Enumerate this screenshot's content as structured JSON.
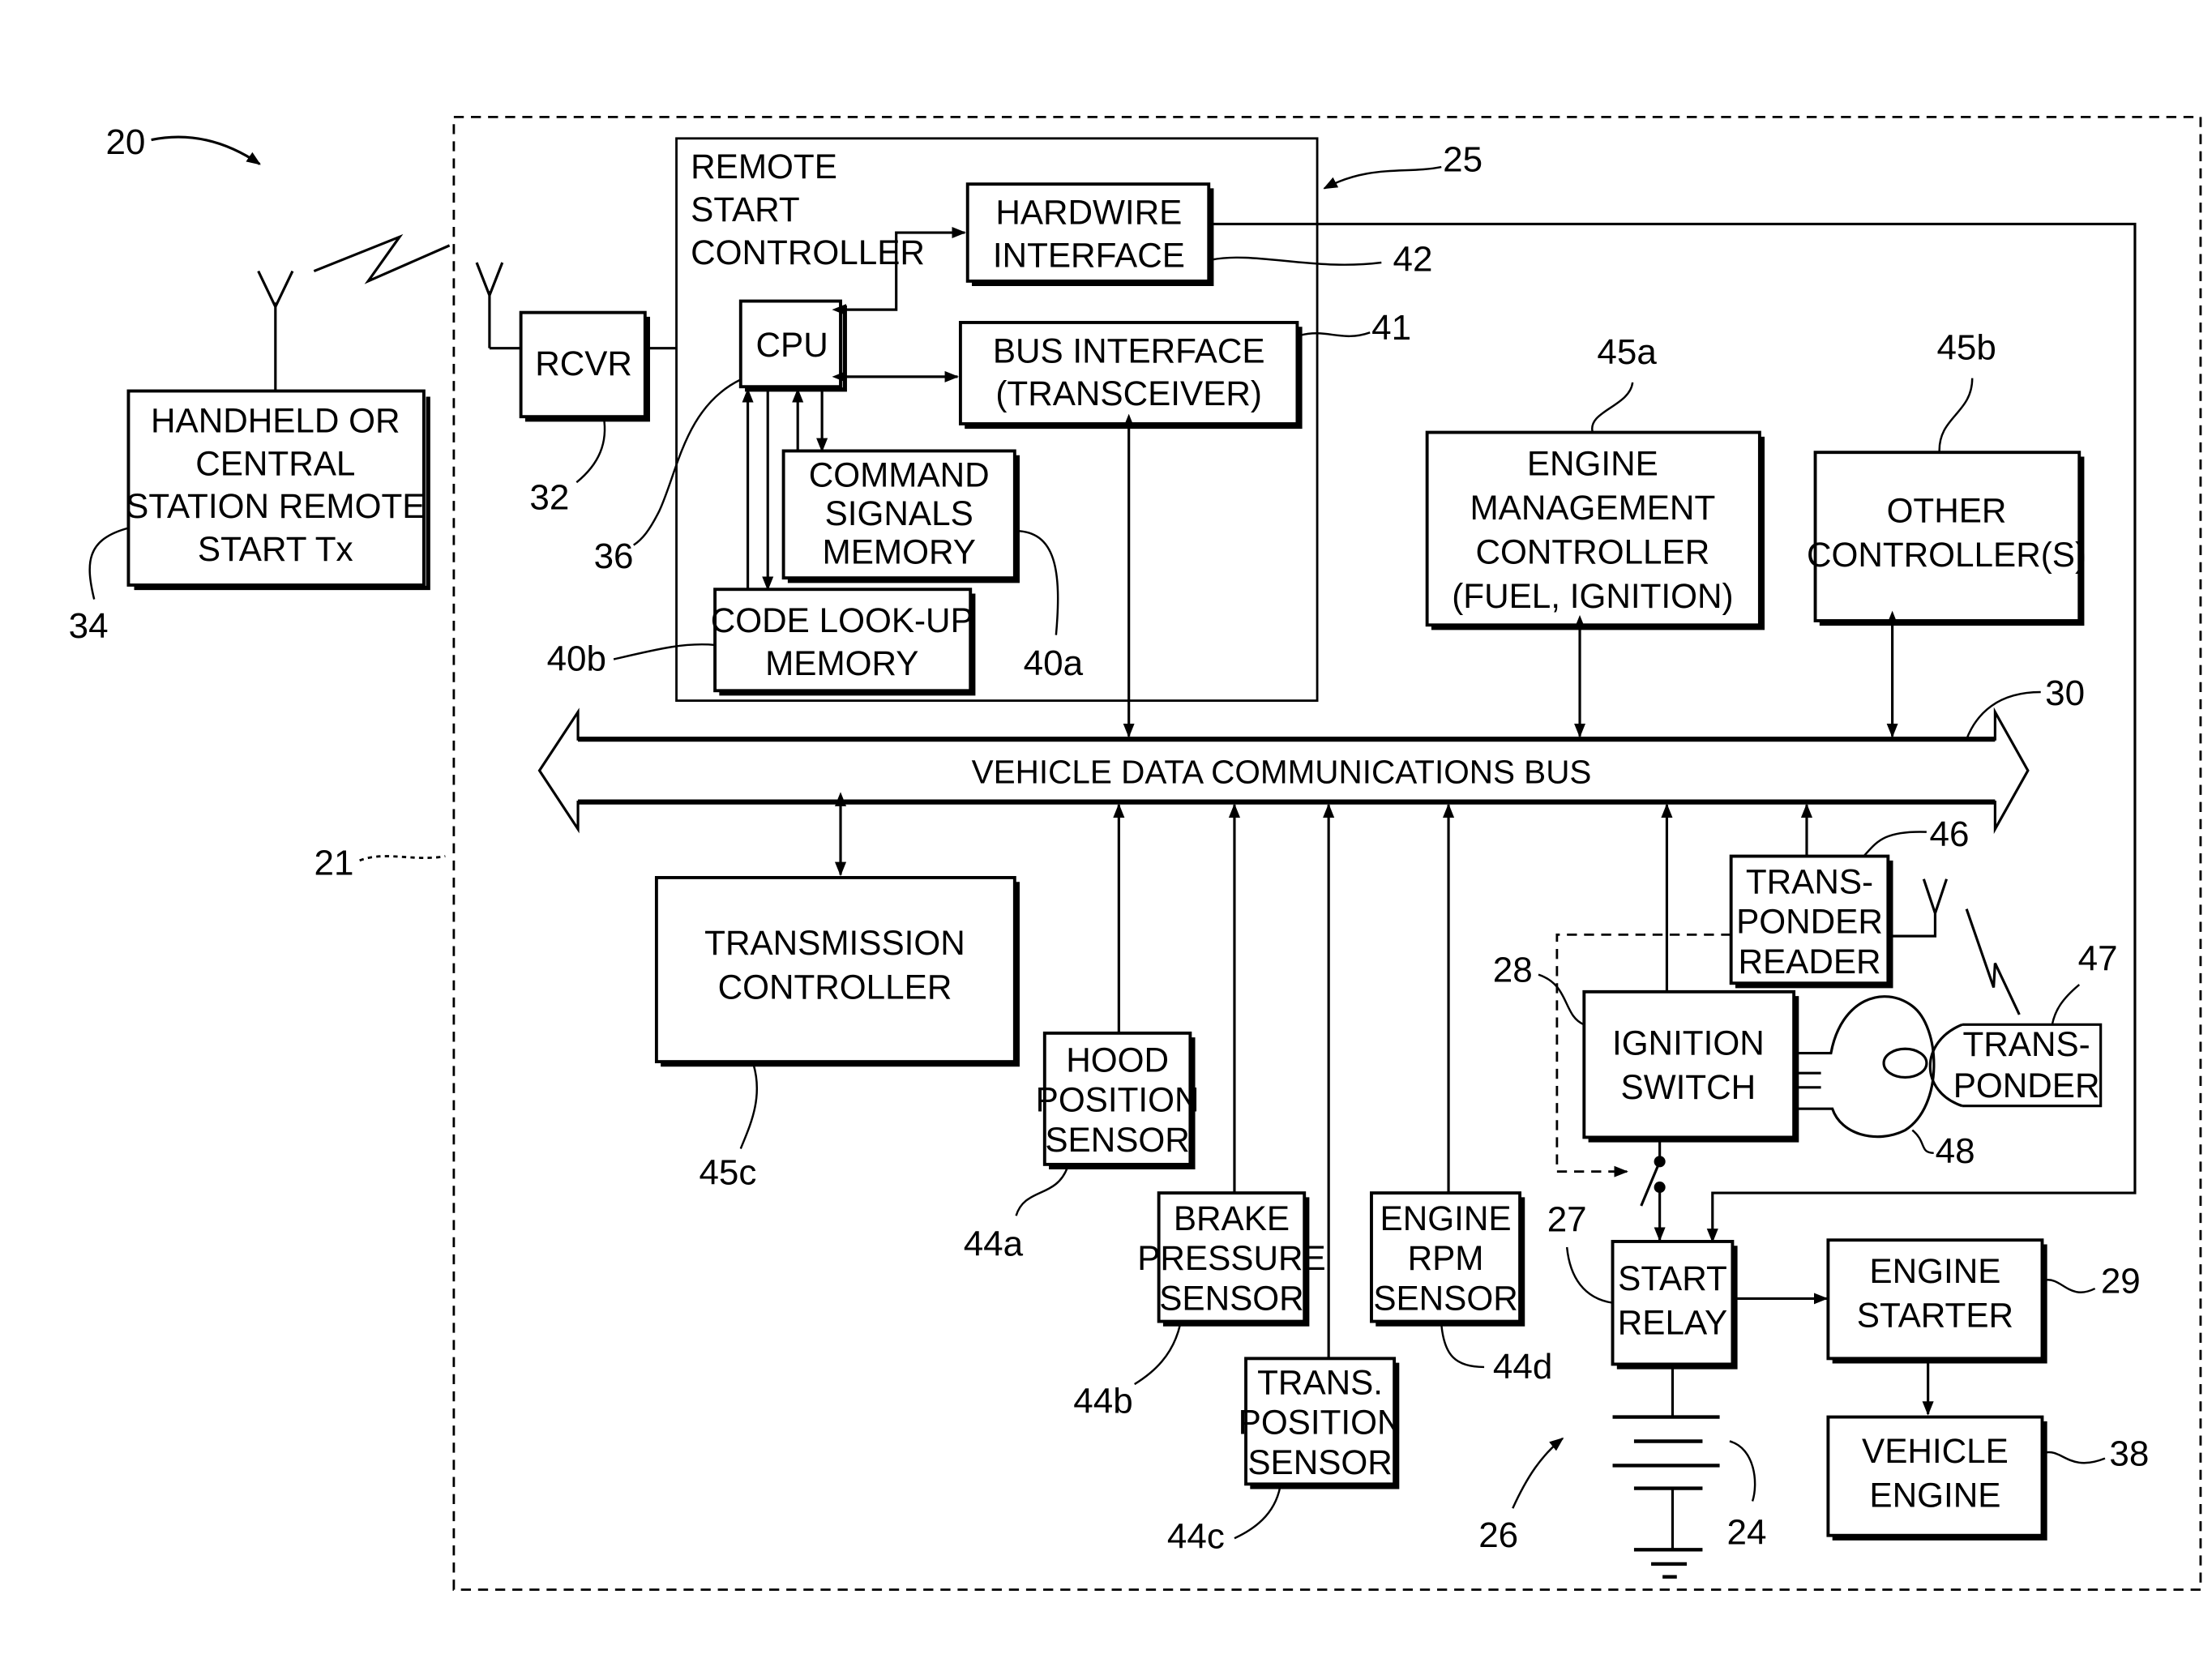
{
  "figure": {
    "ref": "20",
    "vehicle_boundary_ref": "21",
    "remote_start_controller_ref": "25",
    "bus_ref": "30"
  },
  "blocks": {
    "handheld": {
      "lines": [
        "HANDHELD OR",
        "CENTRAL",
        "STATION REMOTE",
        "START Tx"
      ],
      "ref": "34"
    },
    "rcvr": {
      "lines": [
        "RCVR"
      ],
      "ref": "32"
    },
    "remote_start_controller": {
      "lines": [
        "REMOTE",
        "START",
        "CONTROLLER"
      ]
    },
    "cpu": {
      "lines": [
        "CPU"
      ],
      "ref": "36"
    },
    "hardwire_interface": {
      "lines": [
        "HARDWIRE",
        "INTERFACE"
      ],
      "ref": "42"
    },
    "bus_interface": {
      "lines": [
        "BUS INTERFACE",
        "(TRANSCEIVER)"
      ],
      "ref": "41"
    },
    "command_signals_memory": {
      "lines": [
        "COMMAND",
        "SIGNALS",
        "MEMORY"
      ],
      "ref": "40a"
    },
    "code_lookup_memory": {
      "lines": [
        "CODE LOOK-UP",
        "MEMORY"
      ],
      "ref": "40b"
    },
    "engine_management": {
      "lines": [
        "ENGINE",
        "MANAGEMENT",
        "CONTROLLER",
        "(FUEL, IGNITION)"
      ],
      "ref": "45a"
    },
    "other_controllers": {
      "lines": [
        "OTHER",
        "CONTROLLER(S)"
      ],
      "ref": "45b"
    },
    "transmission_controller": {
      "lines": [
        "TRANSMISSION",
        "CONTROLLER"
      ],
      "ref": "45c"
    },
    "hood_sensor": {
      "lines": [
        "HOOD",
        "POSITION",
        "SENSOR"
      ],
      "ref": "44a"
    },
    "brake_sensor": {
      "lines": [
        "BRAKE",
        "PRESSURE",
        "SENSOR"
      ],
      "ref": "44b"
    },
    "trans_sensor": {
      "lines": [
        "TRANS.",
        "POSITION",
        "SENSOR"
      ],
      "ref": "44c"
    },
    "rpm_sensor": {
      "lines": [
        "ENGINE",
        "RPM",
        "SENSOR"
      ],
      "ref": "44d"
    },
    "transponder_reader": {
      "lines": [
        "TRANS-",
        "PONDER",
        "READER"
      ],
      "ref": "46"
    },
    "transponder": {
      "lines": [
        "TRANS-",
        "PONDER"
      ],
      "ref": "47"
    },
    "ignition_switch": {
      "lines": [
        "IGNITION",
        "SWITCH"
      ],
      "ref": "28"
    },
    "start_relay": {
      "lines": [
        "START",
        "RELAY"
      ],
      "ref": "27"
    },
    "engine_starter": {
      "lines": [
        "ENGINE",
        "STARTER"
      ],
      "ref": "29"
    },
    "vehicle_engine": {
      "lines": [
        "VEHICLE",
        "ENGINE"
      ],
      "ref": "38"
    }
  },
  "bus_label": "VEHICLE DATA COMMUNICATIONS BUS",
  "misc_refs": {
    "key": "48",
    "battery": "24",
    "start_circuit": "26"
  }
}
